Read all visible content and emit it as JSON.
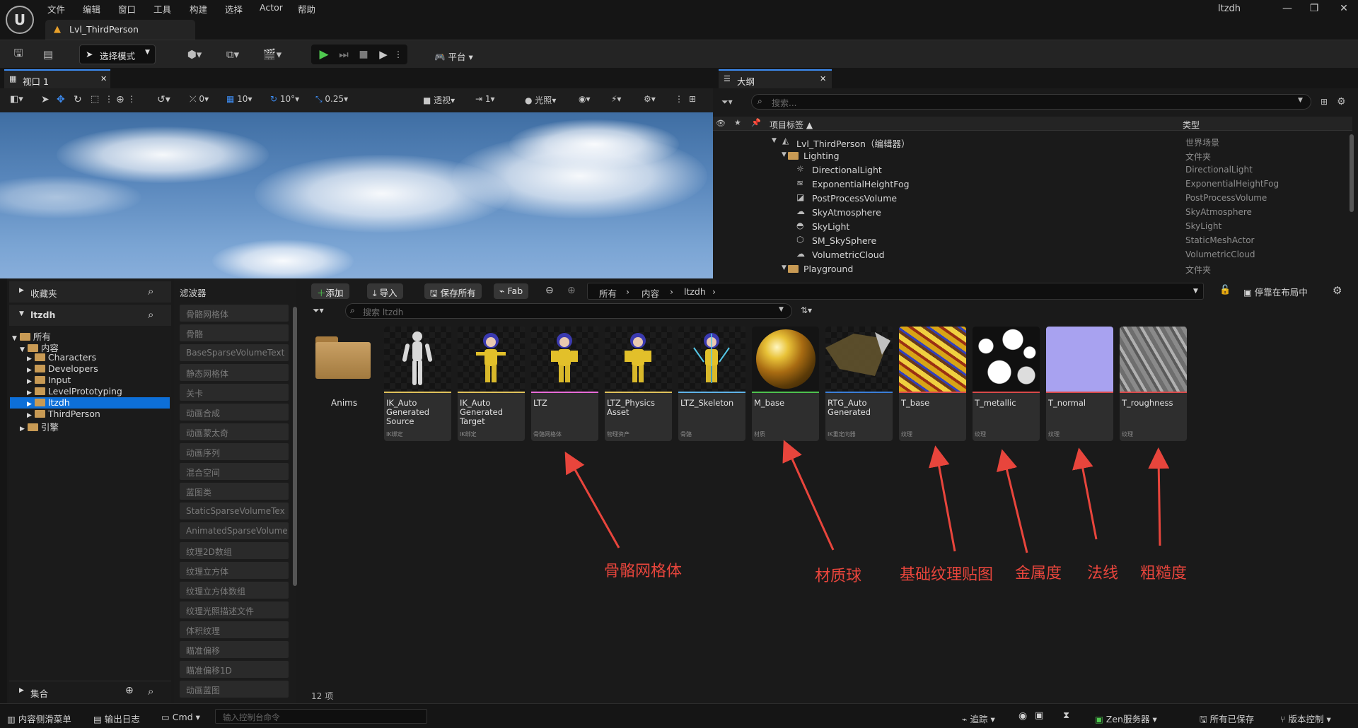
{
  "app": {
    "logo": "unreal-engine-logo",
    "user": "ltzdh"
  },
  "menu": [
    "文件",
    "编辑",
    "窗口",
    "工具",
    "构建",
    "选择",
    "Actor",
    "帮助"
  ],
  "level_tab": "Lvl_ThirdPerson",
  "toolbar": {
    "mode": "选择模式",
    "platform": "平台"
  },
  "viewport": {
    "tab": "视口 1",
    "grid_snap": "10",
    "rotate_snap": "10°",
    "scale_snap": "0.25",
    "camera_speed": "1",
    "angle_value": "0",
    "perspective": "透视",
    "lighting": "光照"
  },
  "outliner": {
    "tab": "大纲",
    "search_placeholder": "搜索...",
    "col_label": "项目标签 ▲",
    "col_type": "类型",
    "rows": [
      {
        "name": "Lvl_ThirdPerson（编辑器）",
        "type": "世界场景"
      },
      {
        "name": "Lighting",
        "type": "文件夹"
      },
      {
        "name": "DirectionalLight",
        "type": "DirectionalLight"
      },
      {
        "name": "ExponentialHeightFog",
        "type": "ExponentialHeightFog"
      },
      {
        "name": "PostProcessVolume",
        "type": "PostProcessVolume"
      },
      {
        "name": "SkyAtmosphere",
        "type": "SkyAtmosphere"
      },
      {
        "name": "SkyLight",
        "type": "SkyLight"
      },
      {
        "name": "SM_SkySphere",
        "type": "StaticMeshActor"
      },
      {
        "name": "VolumetricCloud",
        "type": "VolumetricCloud"
      },
      {
        "name": "Playground",
        "type": "文件夹"
      }
    ]
  },
  "content_browser": {
    "favorites": "收藏夹",
    "project": "ltzdh",
    "collections": "集合",
    "filters_title": "滤波器",
    "tree": {
      "all": "所有",
      "content": "内容",
      "characters": "Characters",
      "developers": "Developers",
      "input": "Input",
      "levelprototyping": "LevelPrototyping",
      "ltzdh": "ltzdh",
      "thirdperson": "ThirdPerson",
      "engine": "引擎"
    },
    "filters": [
      "骨骼网格体",
      "骨骼",
      "BaseSparseVolumeText",
      "静态网格体",
      "关卡",
      "动画合成",
      "动画蒙太奇",
      "动画序列",
      "混合空间",
      "蓝图类",
      "StaticSparseVolumeTex",
      "AnimatedSparseVolume",
      "纹理2D数组",
      "纹理立方体",
      "纹理立方体数组",
      "纹理光照描述文件",
      "体积纹理",
      "瞄准偏移",
      "瞄准偏移1D",
      "动画蓝图"
    ],
    "buttons": {
      "add": "添加",
      "import": "导入",
      "save_all": "保存所有",
      "fab": "Fab"
    },
    "path": [
      "所有",
      "内容",
      "ltzdh"
    ],
    "dock": "停靠在布局中",
    "search_placeholder": "搜索 ltzdh",
    "count": "12 项",
    "folder": "Anims",
    "assets": [
      {
        "name": "IK_Auto Generated Source",
        "type": "IK绑定"
      },
      {
        "name": "IK_Auto Generated Target",
        "type": "IK绑定"
      },
      {
        "name": "LTZ",
        "type": "骨骼网格体"
      },
      {
        "name": "LTZ_Physics Asset",
        "type": "物理资产"
      },
      {
        "name": "LTZ_Skeleton",
        "type": "骨骼"
      },
      {
        "name": "M_base",
        "type": "材质"
      },
      {
        "name": "RTG_Auto Generated",
        "type": "IK重定向器"
      },
      {
        "name": "T_base",
        "type": "纹理"
      },
      {
        "name": "T_metallic",
        "type": "纹理"
      },
      {
        "name": "T_normal",
        "type": "纹理"
      },
      {
        "name": "T_roughness",
        "type": "纹理"
      }
    ],
    "asset_colors": [
      "#e0c25b",
      "#e0c25b",
      "#e86bd8",
      "#e0c25b",
      "#5fb3e8",
      "#4ec24e",
      "#3b7fd9",
      "#d94a4a",
      "#d94a4a",
      "#d94a4a",
      "#d94a4a"
    ]
  },
  "annotations": [
    "骨骼网格体",
    "材质球",
    "基础纹理贴图",
    "金属度",
    "法线",
    "粗糙度"
  ],
  "statusbar": {
    "drawer": "内容侧滑菜单",
    "log": "输出日志",
    "cmd": "Cmd",
    "cmd_placeholder": "输入控制台命令",
    "trace": "追踪",
    "zen": "Zen服务器",
    "saved": "所有已保存",
    "vcs": "版本控制"
  }
}
